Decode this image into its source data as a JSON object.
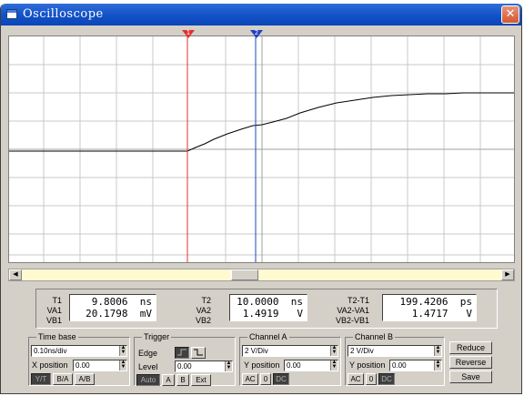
{
  "window": {
    "title": "Oscilloscope",
    "close_glyph": "✕",
    "icon": "window-icon"
  },
  "cursors": {
    "c1_label": "1",
    "c2_label": "2",
    "c1_color": "#e03030",
    "c2_color": "#2040c0"
  },
  "trace": {
    "color": "#000000",
    "baseline_div": 0.0,
    "note_shape": "flat then rising step response"
  },
  "readout": {
    "t1_label": "T1",
    "t1_value": "9.8006  ns",
    "va1_label": "VA1",
    "va1_value": "20.1798  mV",
    "vb1_label": "VB1",
    "vb1_value": "",
    "t2_label": "T2",
    "t2_value": "10.0000  ns",
    "va2_label": "VA2",
    "va2_value": "1.4919   V",
    "vb2_label": "VB2",
    "vb2_value": "",
    "dt_label": "T2-T1",
    "dt_value": "199.4206  ps",
    "dva_label": "VA2-VA1",
    "dva_value": "1.4717   V",
    "dvb_label": "VB2-VB1",
    "dvb_value": ""
  },
  "timebase": {
    "title": "Time base",
    "value": "0.10ns/div",
    "xpos_label": "X position",
    "xpos_value": "0.00",
    "btn_yt": "Y/T",
    "btn_ba": "B/A",
    "btn_ab": "A/B"
  },
  "trigger": {
    "title": "Trigger",
    "edge_label": "Edge",
    "level_label": "Level",
    "level_value": "0.00",
    "btn_auto": "Auto",
    "btn_a": "A",
    "btn_b": "B",
    "btn_ext": "Ext"
  },
  "channel_a": {
    "title": "Channel A",
    "scale": "2 V/Div",
    "ypos_label": "Y position",
    "ypos_value": "0.00",
    "btn_ac": "AC",
    "btn_zero": "0",
    "btn_dc": "DC"
  },
  "channel_b": {
    "title": "Channel B",
    "scale": "2 V/Div",
    "ypos_label": "Y position",
    "ypos_value": "0.00",
    "btn_ac": "AC",
    "btn_zero": "0",
    "btn_dc": "DC"
  },
  "actions": {
    "reduce": "Reduce",
    "reverse": "Reverse",
    "save": "Save"
  }
}
